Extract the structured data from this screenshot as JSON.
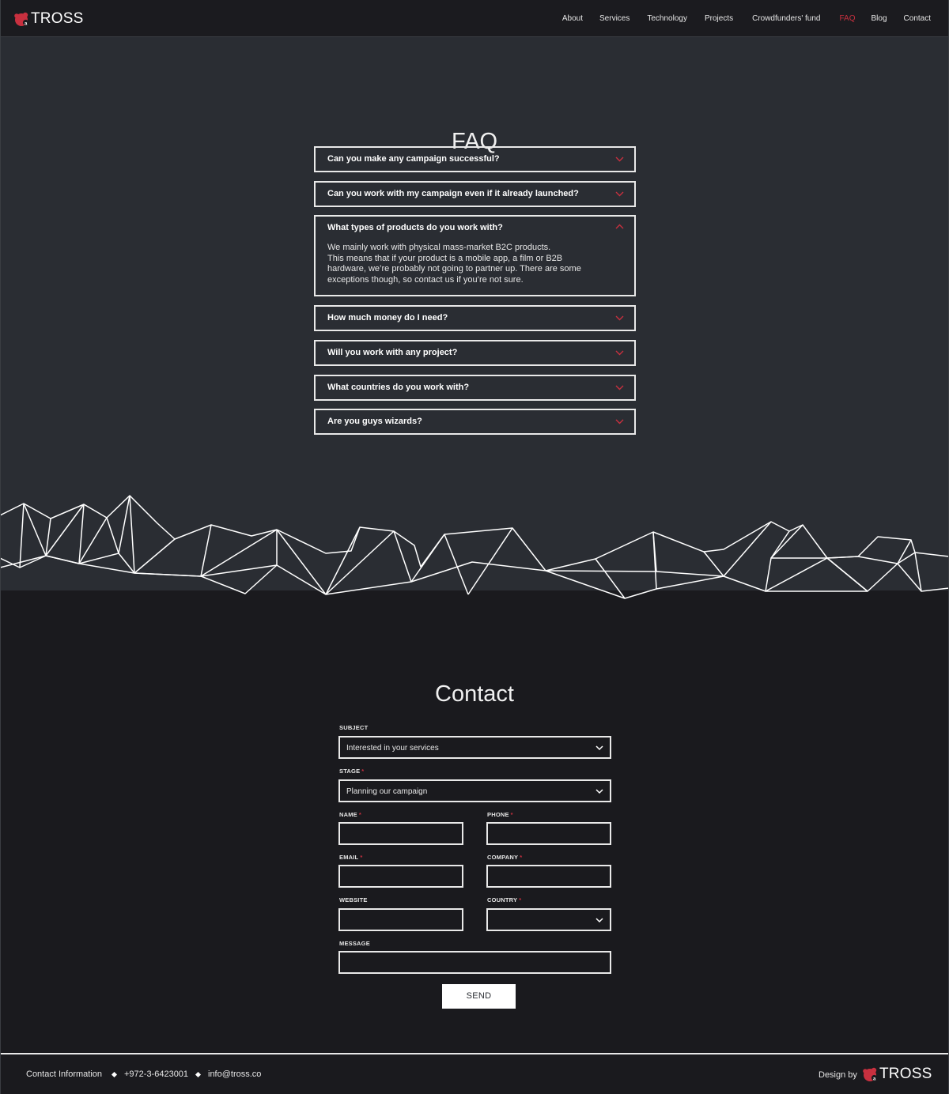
{
  "brand": {
    "name": "TROSS",
    "accent_color": "#c8303f"
  },
  "nav": {
    "items": [
      {
        "label": "About",
        "active": false
      },
      {
        "label": "Services",
        "active": false
      },
      {
        "label": "Technology",
        "active": false
      },
      {
        "label": "Projects",
        "active": false
      },
      {
        "label": "Crowdfunders' fund",
        "active": false
      },
      {
        "label": "FAQ",
        "active": true
      },
      {
        "label": "Blog",
        "active": false
      },
      {
        "label": "Contact",
        "active": false
      }
    ]
  },
  "faq": {
    "title": "FAQ",
    "items": [
      {
        "question": "Can you make any campaign successful?",
        "expanded": false,
        "answer": ""
      },
      {
        "question": "Can you work with my campaign even if it already launched?",
        "expanded": false,
        "answer": ""
      },
      {
        "question": "What types of products do you work with?",
        "expanded": true,
        "answer": "We mainly work with physical mass-market B2C products.\nThis means that if your product is a mobile app, a film or B2B hardware, we’re probably not going to partner up. There are some exceptions though, so contact us if you’re not sure."
      },
      {
        "question": "How much money do I need?",
        "expanded": false,
        "answer": ""
      },
      {
        "question": "Will you work with any project?",
        "expanded": false,
        "answer": ""
      },
      {
        "question": "What countries do you work with?",
        "expanded": false,
        "answer": ""
      },
      {
        "question": "Are you guys wizards?",
        "expanded": false,
        "answer": ""
      }
    ]
  },
  "contact": {
    "title": "Contact",
    "subject": {
      "label": "SUBJECT",
      "required": false,
      "value": "Interested in your services"
    },
    "stage": {
      "label": "STAGE",
      "required": true,
      "value": "Planning our campaign"
    },
    "name": {
      "label": "NAME",
      "required": true,
      "value": ""
    },
    "phone": {
      "label": "PHONE",
      "required": true,
      "value": ""
    },
    "email": {
      "label": "EMAIL",
      "required": true,
      "value": ""
    },
    "company": {
      "label": "COMPANY",
      "required": true,
      "value": ""
    },
    "website": {
      "label": "WEBSITE",
      "required": false,
      "value": ""
    },
    "country": {
      "label": "COUNTRY",
      "required": true,
      "value": ""
    },
    "message": {
      "label": "MESSAGE",
      "required": false,
      "value": ""
    },
    "send_label": "SEND",
    "required_mark": "*"
  },
  "footer": {
    "contact_info_label": "Contact Information",
    "phone": "+972-3-6423001",
    "email": "info@tross.co",
    "design_by_label": "Design by"
  }
}
